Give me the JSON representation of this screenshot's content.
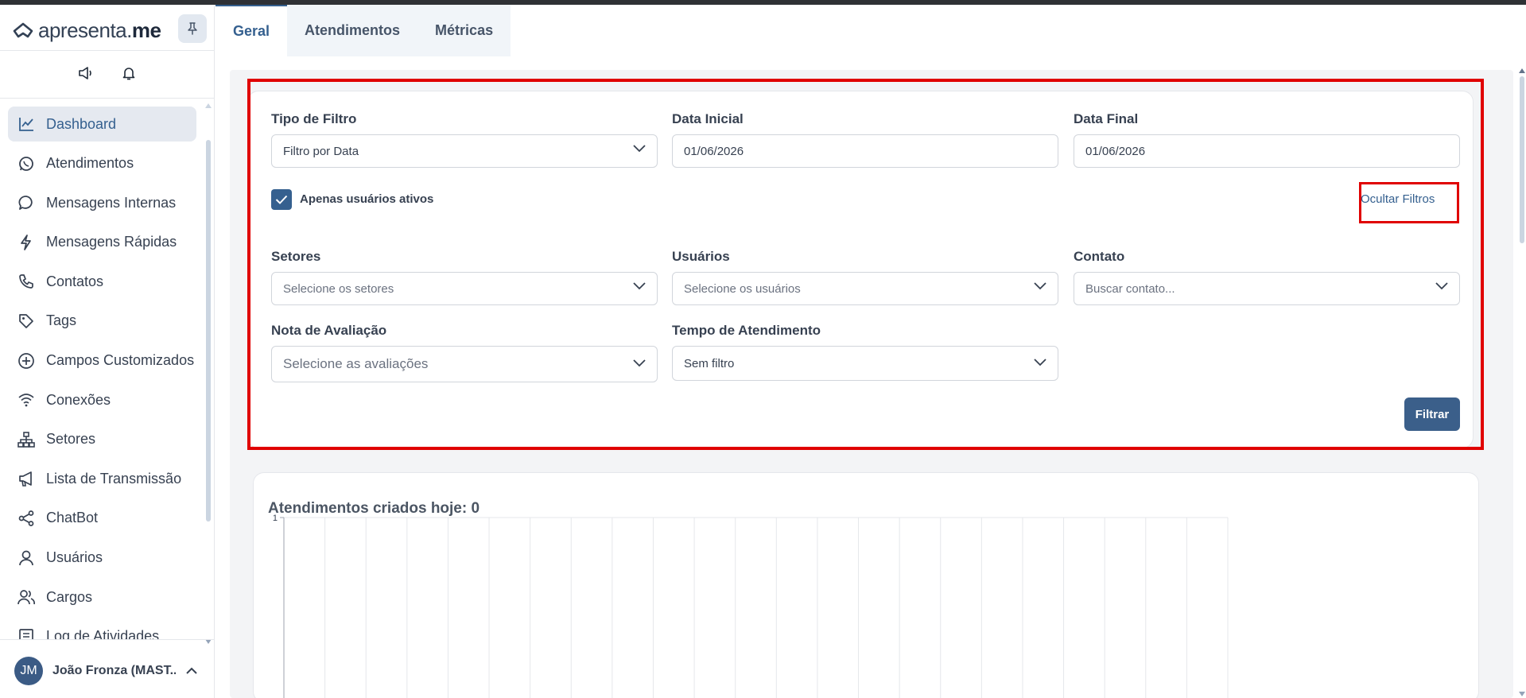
{
  "brand": {
    "name_prefix": "apresenta",
    "name_suffix": "me"
  },
  "sidebar": {
    "items": [
      {
        "label": "Dashboard",
        "icon": "chart-line-icon",
        "active": true
      },
      {
        "label": "Atendimentos",
        "icon": "whatsapp-icon"
      },
      {
        "label": "Mensagens Internas",
        "icon": "chat-bubble-icon"
      },
      {
        "label": "Mensagens Rápidas",
        "icon": "lightning-icon"
      },
      {
        "label": "Contatos",
        "icon": "phone-icon"
      },
      {
        "label": "Tags",
        "icon": "tag-icon"
      },
      {
        "label": "Campos Customizados",
        "icon": "plus-circle-icon"
      },
      {
        "label": "Conexões",
        "icon": "wifi-icon"
      },
      {
        "label": "Setores",
        "icon": "sitemap-icon"
      },
      {
        "label": "Lista de Transmissão",
        "icon": "megaphone-icon"
      },
      {
        "label": "ChatBot",
        "icon": "share-icon"
      },
      {
        "label": "Usuários",
        "icon": "user-icon"
      },
      {
        "label": "Cargos",
        "icon": "users-icon"
      },
      {
        "label": "Log de Atividades",
        "icon": "log-icon"
      }
    ],
    "user": {
      "initials": "JM",
      "name": "João Fronza (MAST..."
    }
  },
  "tabs": [
    "Geral",
    "Atendimentos",
    "Métricas"
  ],
  "filters": {
    "tipo_label": "Tipo de Filtro",
    "tipo_value": "Filtro por Data",
    "data_inicial_label": "Data Inicial",
    "data_inicial_value": "01/06/2026",
    "data_final_label": "Data Final",
    "data_final_value": "01/06/2026",
    "ativos_label": "Apenas usuários ativos",
    "ativos_checked": true,
    "toggle_label": "Ocultar Filtros",
    "setores_label": "Setores",
    "setores_placeholder": "Selecione os setores",
    "usuarios_label": "Usuários",
    "usuarios_placeholder": "Selecione os usuários",
    "contato_label": "Contato",
    "contato_placeholder": "Buscar contato...",
    "nota_label": "Nota de Avaliação",
    "nota_placeholder": "Selecione as avaliações",
    "tempo_label": "Tempo de Atendimento",
    "tempo_value": "Sem filtro",
    "submit_label": "Filtrar"
  },
  "chart_data": {
    "type": "bar",
    "title": "Atendimentos criados hoje: 0",
    "ylim": [
      0,
      1
    ],
    "yticks": [
      "1"
    ],
    "categories_count": 23,
    "values": [
      0,
      0,
      0,
      0,
      0,
      0,
      0,
      0,
      0,
      0,
      0,
      0,
      0,
      0,
      0,
      0,
      0,
      0,
      0,
      0,
      0,
      0,
      0
    ],
    "grid": true
  },
  "colors": {
    "accent": "#35608f",
    "highlight": "#e00000"
  }
}
